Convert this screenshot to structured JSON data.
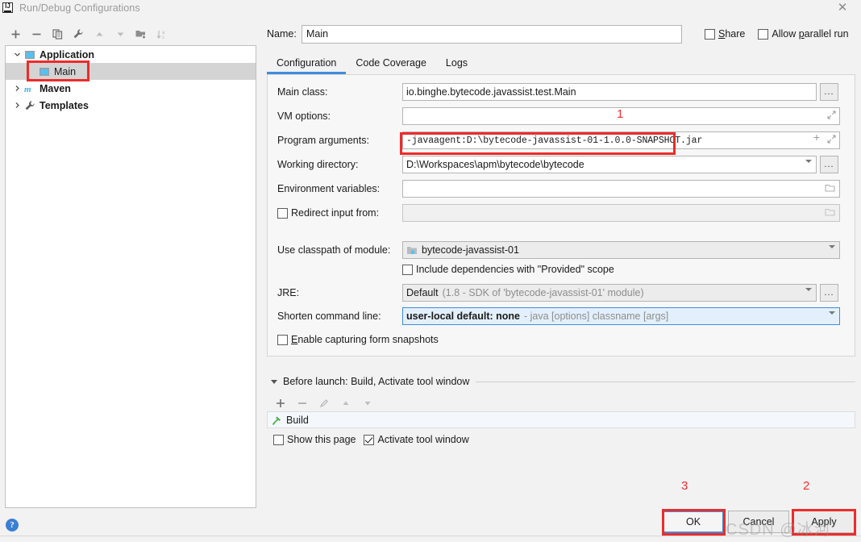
{
  "window": {
    "title": "Run/Debug Configurations",
    "logo_text": "IJ",
    "close_label": "✕"
  },
  "left_panel": {
    "toolbar": [
      {
        "name": "add-configuration-button",
        "label": "+"
      },
      {
        "name": "remove-configuration-button",
        "label": "−"
      },
      {
        "name": "copy-configuration-button",
        "label": "copy-icon"
      },
      {
        "name": "edit-templates-button",
        "label": "wrench-icon"
      },
      {
        "name": "move-up-button",
        "label": "arrow-up-icon"
      },
      {
        "name": "move-down-button",
        "label": "arrow-down-icon"
      },
      {
        "name": "move-into-folder-button",
        "label": "folder-add-icon"
      },
      {
        "name": "sort-configurations-button",
        "label": "sort-az-icon"
      }
    ],
    "tree": [
      {
        "label": "Application",
        "icon": "application-icon",
        "expanded": true,
        "indent": 0,
        "bold": true,
        "selected": false
      },
      {
        "label": "Main",
        "icon": "application-icon",
        "expanded": null,
        "indent": 1,
        "bold": false,
        "selected": true
      },
      {
        "label": "Maven",
        "icon": "maven-icon",
        "expanded": false,
        "indent": 0,
        "bold": true,
        "selected": false
      },
      {
        "label": "Templates",
        "icon": "templates-icon",
        "expanded": false,
        "indent": 0,
        "bold": true,
        "selected": false
      }
    ],
    "help_label": "?"
  },
  "header": {
    "name_label": "Name:",
    "name_value": "Main",
    "share_label": "Share",
    "share_checked": false,
    "parallel_label": "Allow parallel run",
    "parallel_checked": false
  },
  "tabs": [
    {
      "label": "Configuration",
      "active": true
    },
    {
      "label": "Code Coverage",
      "active": false
    },
    {
      "label": "Logs",
      "active": false
    }
  ],
  "form": {
    "main_class": {
      "label": "Main class:",
      "value": "io.binghe.bytecode.javassist.test.Main",
      "browse": "..."
    },
    "vm_options": {
      "label": "VM options:",
      "value": ""
    },
    "program_arguments": {
      "label": "Program arguments:",
      "value": "-javaagent:D:\\bytecode-javassist-01-1.0.0-SNAPSHOT.jar"
    },
    "working_directory": {
      "label": "Working directory:",
      "value": "D:\\Workspaces\\apm\\bytecode\\bytecode",
      "browse": "..."
    },
    "environment_variables": {
      "label": "Environment variables:",
      "value": ""
    },
    "redirect_input": {
      "label": "Redirect input from:",
      "value": "",
      "checked": false
    },
    "use_classpath": {
      "label": "Use classpath of module:",
      "value": "bytecode-javassist-01"
    },
    "include_provided": {
      "label": "Include dependencies with \"Provided\" scope",
      "checked": false
    },
    "jre": {
      "label": "JRE:",
      "value": "Default",
      "hint": "(1.8 - SDK of 'bytecode-javassist-01' module)",
      "browse": "..."
    },
    "shorten_command_line": {
      "label": "Shorten command line:",
      "value": "user-local default: none",
      "hint": "- java [options] classname [args]"
    },
    "enable_snapshots": {
      "label": "Enable capturing form snapshots",
      "checked": false
    }
  },
  "before_launch": {
    "header": "Before launch: Build, Activate tool window",
    "toolbar": [
      {
        "name": "before-launch-add-button",
        "label": "+"
      },
      {
        "name": "before-launch-remove-button",
        "label": "−"
      },
      {
        "name": "before-launch-edit-button",
        "label": "pencil-icon"
      },
      {
        "name": "before-launch-move-up-button",
        "label": "arrow-up-icon"
      },
      {
        "name": "before-launch-move-down-button",
        "label": "arrow-down-icon"
      }
    ],
    "items": [
      {
        "label": "Build",
        "icon": "build-hammer-icon"
      }
    ],
    "show_page": {
      "label": "Show this page",
      "checked": false
    },
    "activate_tool_window": {
      "label": "Activate tool window",
      "checked": true
    }
  },
  "footer": {
    "ok_label": "OK",
    "cancel_label": "Cancel",
    "apply_label": "Apply"
  },
  "annotations": {
    "marker_1": "1",
    "marker_2": "2",
    "marker_3": "3",
    "watermark": "CSDN @冰河"
  },
  "colors": {
    "accent": "#3f8ddd",
    "annotation_red": "#ee2b2b",
    "selection": "#d4d4d4"
  }
}
